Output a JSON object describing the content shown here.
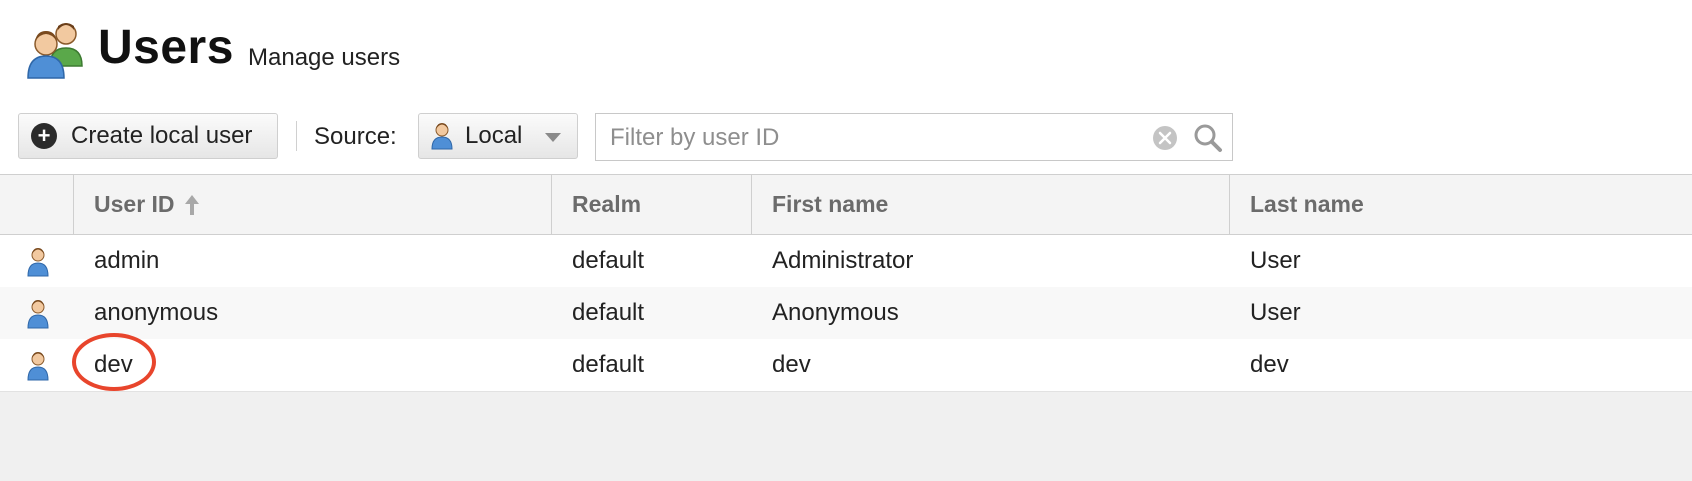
{
  "header": {
    "title": "Users",
    "subtitle": "Manage users",
    "icon": "users-icon"
  },
  "toolbar": {
    "create_label": "Create local user",
    "source_label": "Source:",
    "source_value": "Local",
    "filter_placeholder": "Filter by user ID"
  },
  "table": {
    "columns": [
      "User ID",
      "Realm",
      "First name",
      "Last name"
    ],
    "sorted_by": "User ID",
    "sort_direction": "ascending",
    "rows": [
      {
        "user_id": "admin",
        "realm": "default",
        "first_name": "Administrator",
        "last_name": "User"
      },
      {
        "user_id": "anonymous",
        "realm": "default",
        "first_name": "Anonymous",
        "last_name": "User"
      },
      {
        "user_id": "dev",
        "realm": "default",
        "first_name": "dev",
        "last_name": "dev"
      }
    ]
  },
  "colors": {
    "annotation": "#e8452c",
    "header_text": "#6b6b6b"
  }
}
